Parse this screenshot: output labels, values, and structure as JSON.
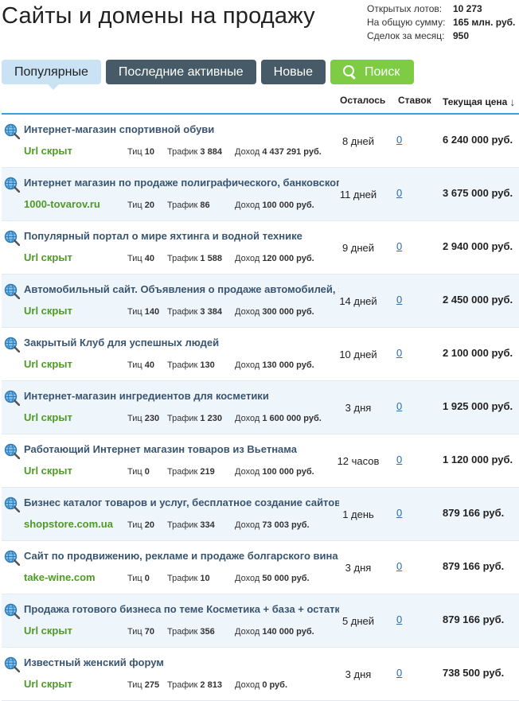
{
  "page_title": "Сайты и домены на продажу",
  "stats": [
    {
      "label": "Открытых лотов:",
      "value": "10 273"
    },
    {
      "label": "На общую сумму:",
      "value": "165 млн. руб."
    },
    {
      "label": "Сделок за месяц:",
      "value": "950"
    }
  ],
  "tabs": {
    "popular": "Популярные",
    "recent": "Последние активные",
    "new": "Новые",
    "search": "Поиск"
  },
  "columns": {
    "remaining": "Осталось",
    "bids": "Ставок",
    "price": "Текущая цена",
    "sort_arrow": "↓"
  },
  "colors": {
    "accent": "#3aa0d8",
    "tab_dark": "#465a67",
    "tab_active": "#c9e3f4",
    "search_green": "#7dcc44",
    "link": "#3a5570",
    "url_green": "#4e9a25"
  },
  "lots": [
    {
      "title": "Интернет-магазин спортивной обуви",
      "url": "Url скрыт",
      "tic_label": "Тиц",
      "tic": "10",
      "traffic_label": "Трафик",
      "traffic": "3 884",
      "income_label": "Доход",
      "income": "4 437 291 руб.",
      "remaining": "8 дней",
      "bids": "0",
      "price": "6 240 000 руб."
    },
    {
      "title": "Интернет магазин по продаже полиграфического, банковского оборудования",
      "url": "1000-tovarov.ru",
      "tic_label": "Тиц",
      "tic": "20",
      "traffic_label": "Трафик",
      "traffic": "86",
      "income_label": "Доход",
      "income": "100 000 руб.",
      "remaining": "11 дней",
      "bids": "0",
      "price": "3 675 000 руб."
    },
    {
      "title": "Популярный портал о мире яхтинга и водной технике",
      "url": "Url скрыт",
      "tic_label": "Тиц",
      "tic": "40",
      "traffic_label": "Трафик",
      "traffic": "1 588",
      "income_label": "Доход",
      "income": "120 000 руб.",
      "remaining": "9 дней",
      "bids": "0",
      "price": "2 940 000 руб."
    },
    {
      "title": "Автомобильный сайт. Объявления о продаже автомобилей, запчастей",
      "url": "Url скрыт",
      "tic_label": "Тиц",
      "tic": "140",
      "traffic_label": "Трафик",
      "traffic": "3 384",
      "income_label": "Доход",
      "income": "300 000 руб.",
      "remaining": "14 дней",
      "bids": "0",
      "price": "2 450 000 руб."
    },
    {
      "title": "Закрытый Клуб для успешных людей",
      "url": "Url скрыт",
      "tic_label": "Тиц",
      "tic": "40",
      "traffic_label": "Трафик",
      "traffic": "130",
      "income_label": "Доход",
      "income": "130 000 руб.",
      "remaining": "10 дней",
      "bids": "0",
      "price": "2 100 000 руб."
    },
    {
      "title": "Интернет-магазин ингредиентов для косметики",
      "url": "Url скрыт",
      "tic_label": "Тиц",
      "tic": "230",
      "traffic_label": "Трафик",
      "traffic": "1 230",
      "income_label": "Доход",
      "income": "1 600 000 руб.",
      "remaining": "3 дня",
      "bids": "0",
      "price": "1 925 000 руб."
    },
    {
      "title": "Работающий Интернет магазин товаров из Вьетнама",
      "url": "Url скрыт",
      "tic_label": "Тиц",
      "tic": "0",
      "traffic_label": "Трафик",
      "traffic": "219",
      "income_label": "Доход",
      "income": "100 000 руб.",
      "remaining": "12 часов",
      "bids": "0",
      "price": "1 120 000 руб."
    },
    {
      "title": "Бизнес каталог товаров и услуг, бесплатное создание сайтов",
      "url": "shopstore.com.ua",
      "tic_label": "Тиц",
      "tic": "20",
      "traffic_label": "Трафик",
      "traffic": "334",
      "income_label": "Доход",
      "income": "73 003 руб.",
      "remaining": "1 день",
      "bids": "0",
      "price": "879 166 руб."
    },
    {
      "title": "Сайт по продвижению, рекламе и продаже болгарского вина",
      "url": "take-wine.com",
      "tic_label": "Тиц",
      "tic": "0",
      "traffic_label": "Трафик",
      "traffic": "10",
      "income_label": "Доход",
      "income": "50 000 руб.",
      "remaining": "3 дня",
      "bids": "0",
      "price": "879 166 руб."
    },
    {
      "title": "Продажа готового бизнеса по теме Косметика + база + остатки",
      "url": "Url скрыт",
      "tic_label": "Тиц",
      "tic": "70",
      "traffic_label": "Трафик",
      "traffic": "356",
      "income_label": "Доход",
      "income": "140 000 руб.",
      "remaining": "5 дней",
      "bids": "0",
      "price": "879 166 руб."
    },
    {
      "title": "Известный женский форум",
      "url": "Url скрыт",
      "tic_label": "Тиц",
      "tic": "275",
      "traffic_label": "Трафик",
      "traffic": "2 813",
      "income_label": "Доход",
      "income": "0 руб.",
      "remaining": "3 дня",
      "bids": "0",
      "price": "738 500 руб."
    }
  ]
}
